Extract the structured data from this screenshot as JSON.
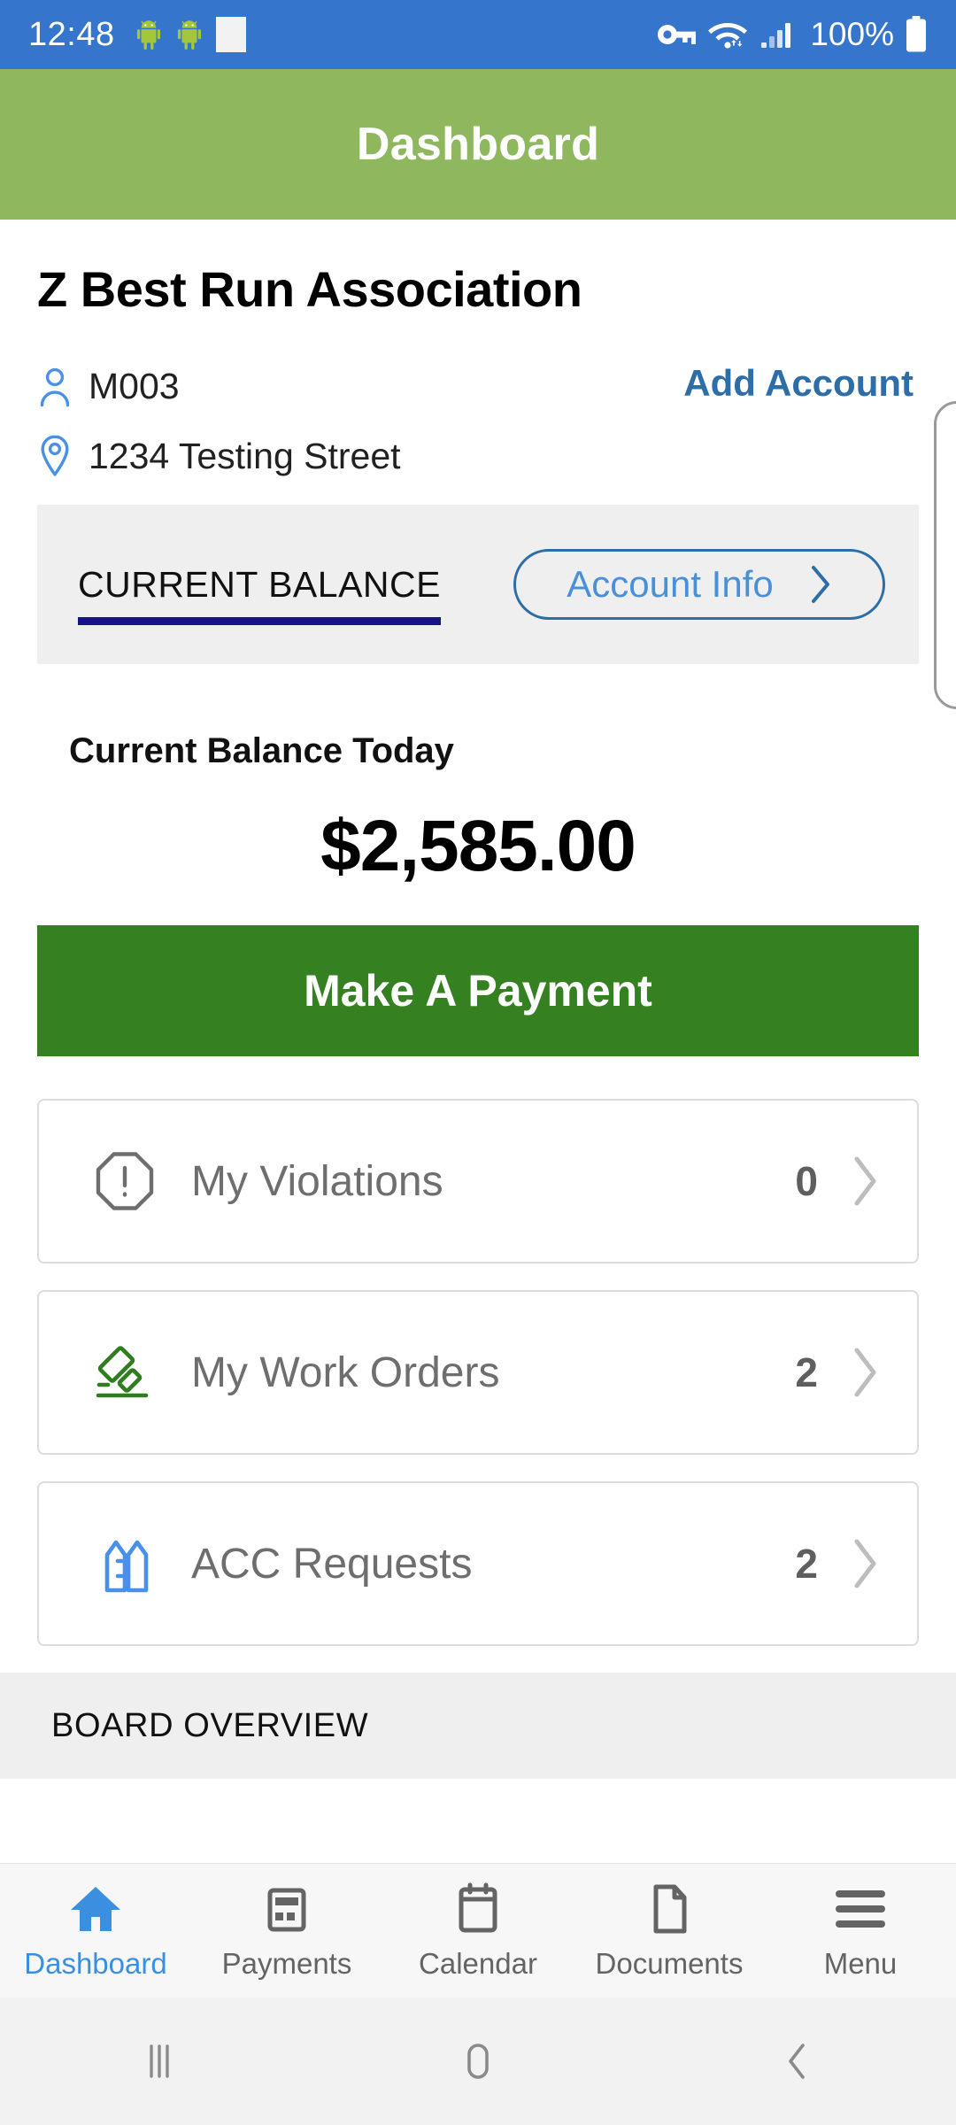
{
  "status_bar": {
    "time": "12:48",
    "battery_percent": "100%",
    "icons": [
      "android-robot-icon",
      "android-robot-icon",
      "white-square-icon",
      "vpn-key-icon",
      "wifi-icon",
      "cellular-signal-icon",
      "battery-full-icon"
    ],
    "background_color": "#3575CB"
  },
  "app_bar": {
    "title": "Dashboard",
    "background_color": "#8FB85E"
  },
  "account": {
    "association_name": "Z Best Run Association",
    "member_id": "M003",
    "address": "1234 Testing Street",
    "add_account_label": "Add Account",
    "add_account_color": "#2D6DA8"
  },
  "tabs": {
    "current_tab_label": "CURRENT BALANCE",
    "underline_color": "#141484",
    "account_info_label": "Account Info"
  },
  "balance": {
    "subtitle": "Current Balance Today",
    "amount": "$2,585.00",
    "pay_button_label": "Make A Payment",
    "pay_button_color": "#358021"
  },
  "stat_cards": [
    {
      "icon": "alert-octagon-icon",
      "label": "My Violations",
      "count": "0",
      "icon_color": "#6E6E6E"
    },
    {
      "icon": "gavel-icon",
      "label": "My Work Orders",
      "count": "2",
      "icon_color": "#2E7D1E"
    },
    {
      "icon": "fence-icon",
      "label": "ACC Requests",
      "count": "2",
      "icon_color": "#4A90E8"
    }
  ],
  "board_section": {
    "title": "BOARD OVERVIEW"
  },
  "bottom_nav": {
    "active_color": "#3B8FE0",
    "items": [
      {
        "icon": "home-icon",
        "label": "Dashboard",
        "active": true
      },
      {
        "icon": "credit-card-icon",
        "label": "Payments",
        "active": false
      },
      {
        "icon": "calendar-icon",
        "label": "Calendar",
        "active": false
      },
      {
        "icon": "document-icon",
        "label": "Documents",
        "active": false
      },
      {
        "icon": "hamburger-menu-icon",
        "label": "Menu",
        "active": false
      }
    ]
  },
  "android_nav": {
    "recents_icon": "recents-icon",
    "home_icon": "home-square-icon",
    "back_icon": "back-chevron-icon"
  }
}
